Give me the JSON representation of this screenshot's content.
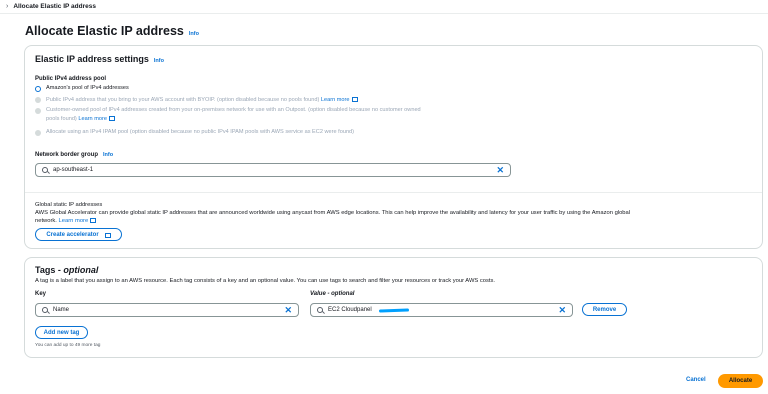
{
  "breadcrumb": {
    "current": "Allocate Elastic IP address"
  },
  "page": {
    "title": "Allocate Elastic IP address",
    "info": "Info"
  },
  "settings": {
    "title": "Elastic IP address settings",
    "info": "Info",
    "pool_label": "Public IPv4 address pool",
    "options": [
      {
        "text": "Amazon's pool of IPv4 addresses",
        "selected": true,
        "disabled": false
      },
      {
        "text": "Public IPv4 address that you bring to your AWS account with BYOIP. (option disabled because no pools found)",
        "link": "Learn more",
        "selected": false,
        "disabled": true
      },
      {
        "text": "Customer-owned pool of IPv4 addresses created from your on-premises network for use with an Outpost. (option disabled because no customer owned",
        "text2": "pools found)",
        "link": "Learn more",
        "selected": false,
        "disabled": true
      },
      {
        "text": "Allocate using an IPv4 IPAM pool (option disabled because no public IPv4 IPAM pools with AWS service as EC2 were found)",
        "selected": false,
        "disabled": true
      }
    ],
    "border_group_label": "Network border group",
    "border_group_info": "Info",
    "border_group_value": "ap-southeast-1"
  },
  "accelerator": {
    "title": "Global static IP addresses",
    "desc": "AWS Global Accelerator can provide global static IP addresses that are announced worldwide using anycast from AWS edge locations. This can help improve the availability and latency for your user traffic by using the Amazon global",
    "desc2": "network.",
    "link": "Learn more",
    "button": "Create accelerator"
  },
  "tags": {
    "title": "Tags - optional",
    "desc": "A tag is a label that you assign to an AWS resource. Each tag consists of a key and an optional value. You can use tags to search and filter your resources or track your AWS costs.",
    "key_label": "Key",
    "value_label": "Value - optional",
    "key_value": "Name",
    "value_value": "EC2 Cloudpanel",
    "remove": "Remove",
    "add": "Add new tag",
    "hint": "You can add up to 49 more tag"
  },
  "footer": {
    "cancel": "Cancel",
    "allocate": "Allocate"
  },
  "colors": {
    "accent": "#0972d3",
    "primary": "#ff9900",
    "border": "#d5dbdb"
  }
}
